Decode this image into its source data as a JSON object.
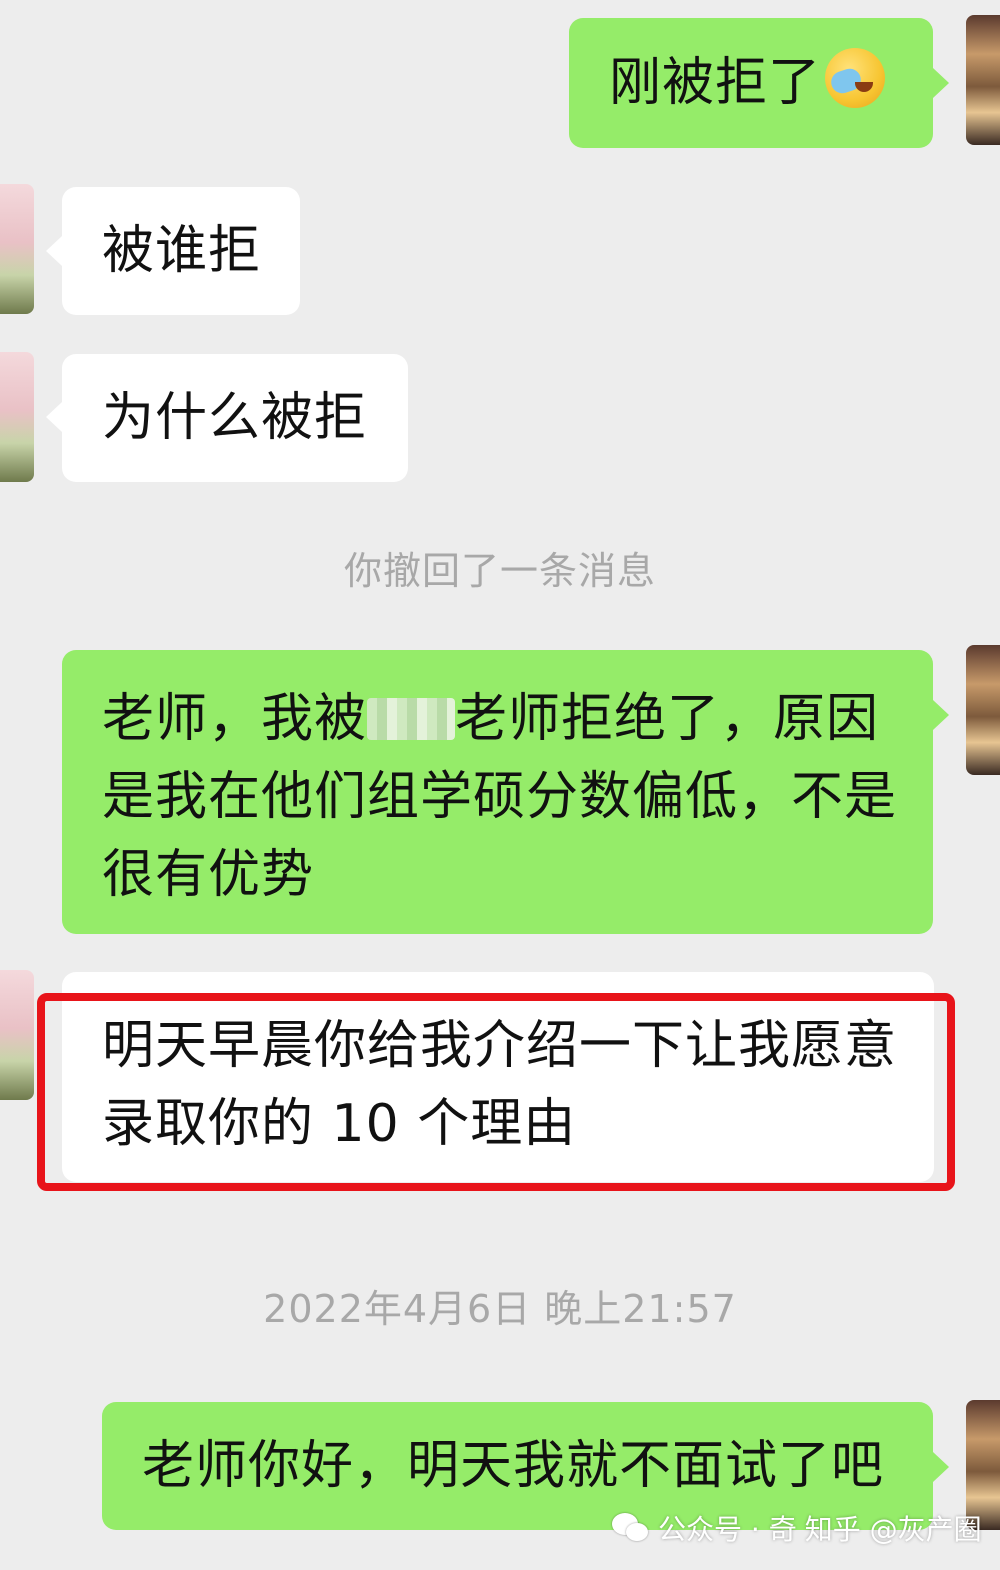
{
  "messages": [
    {
      "side": "right",
      "text": "刚被拒了",
      "emoji": "face-palm-crying-emoji"
    },
    {
      "side": "left",
      "text": "被谁拒"
    },
    {
      "side": "left",
      "text": "为什么被拒"
    },
    {
      "side": "right",
      "text_before_blur": "老师，我被",
      "text_after_blur": "老师拒绝了，原因\n是我在他们组学硕分数偏低，不是\n很有优势"
    },
    {
      "side": "left",
      "text": "明天早晨你给我介绍一下让我愿意\n录取你的 10 个理由",
      "highlighted": true
    },
    {
      "side": "right",
      "text": "老师你好，明天我就不面试了吧"
    }
  ],
  "system_messages": {
    "recall": "你撤回了一条消息",
    "timestamp": "2022年4月6日 晚上21:57"
  },
  "watermark": {
    "left": "公众号 · 奇",
    "right": "知乎 @灰产圈"
  },
  "colors": {
    "background": "#ededed",
    "bubble_green": "#95ec69",
    "bubble_white": "#ffffff",
    "highlight_red": "#e8141a",
    "system_text": "#a8a8a8"
  }
}
